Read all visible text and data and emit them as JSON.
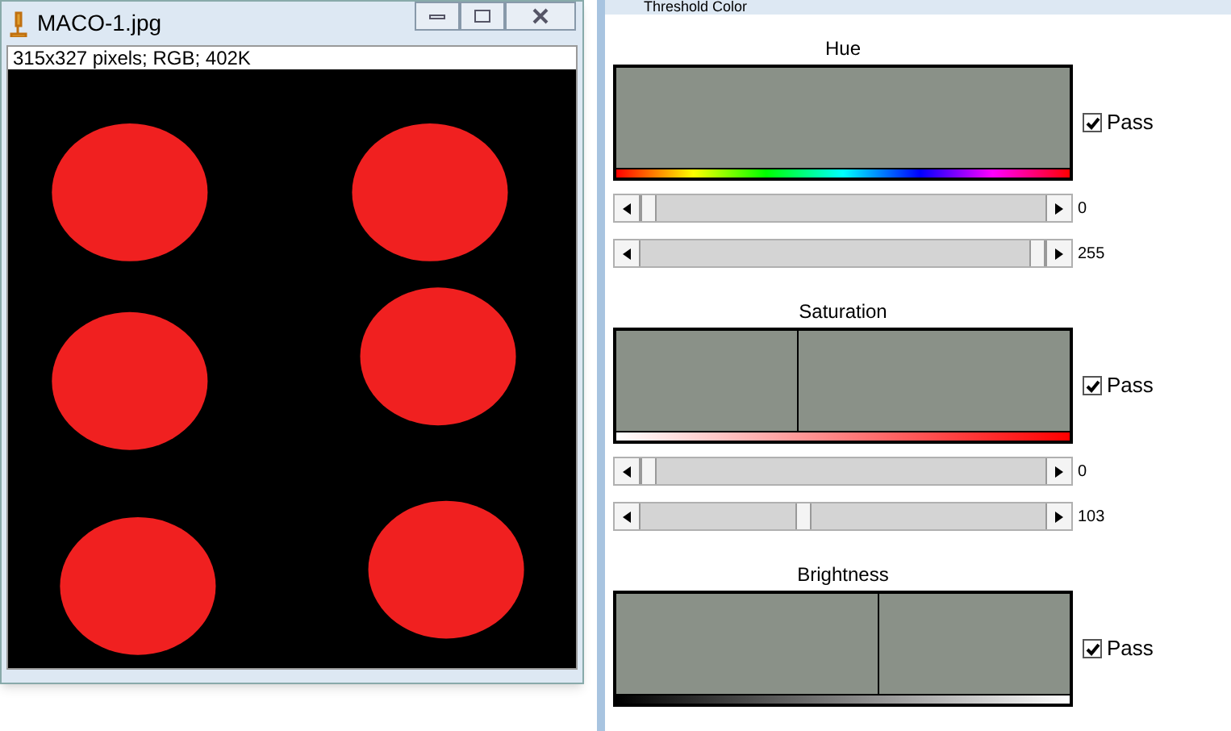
{
  "image_window": {
    "title": "MACO-1.jpg",
    "info": "315x327 pixels; RGB; 402K"
  },
  "threshold_window": {
    "title": "Threshold Color",
    "sections": [
      {
        "kind": "hue",
        "label": "Hue",
        "pass": true,
        "pass_label": "Pass",
        "sliders": [
          {
            "level": 0,
            "reading": "0"
          },
          {
            "level": 1,
            "reading": "255"
          }
        ]
      },
      {
        "kind": "saturation",
        "label": "Saturation",
        "pass": true,
        "pass_label": "Pass",
        "sliders": [
          {
            "level": 0,
            "reading": "0"
          },
          {
            "level": 0.4,
            "reading": "103"
          }
        ]
      },
      {
        "kind": "brightness",
        "label": "Brightness",
        "pass": true,
        "pass_label": "Pass"
      }
    ]
  }
}
